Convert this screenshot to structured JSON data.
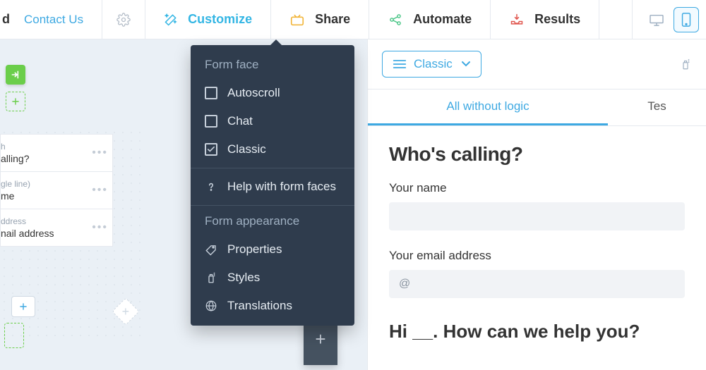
{
  "topbar": {
    "truncated_label": "d",
    "contact_label": "Contact Us",
    "tabs": {
      "customize": "Customize",
      "share": "Share",
      "automate": "Automate",
      "results": "Results"
    }
  },
  "dropdown": {
    "section_face": "Form face",
    "autoscroll": "Autoscroll",
    "chat": "Chat",
    "classic": "Classic",
    "help": "Help with form faces",
    "section_appearance": "Form appearance",
    "properties": "Properties",
    "styles": "Styles",
    "translations": "Translations"
  },
  "builder": {
    "cards": [
      {
        "type": "h",
        "label": "alling?"
      },
      {
        "type": "gle line)",
        "label": "me"
      },
      {
        "type": "ddress",
        "label": "nail address"
      }
    ]
  },
  "preview": {
    "mode_label": "Classic",
    "tab_primary": "All without logic",
    "tab_secondary": "Tes",
    "heading": "Who's calling?",
    "name_label": "Your name",
    "email_label": "Your email address",
    "email_placeholder": "@",
    "followup_heading": "Hi __. How can we help you?"
  }
}
